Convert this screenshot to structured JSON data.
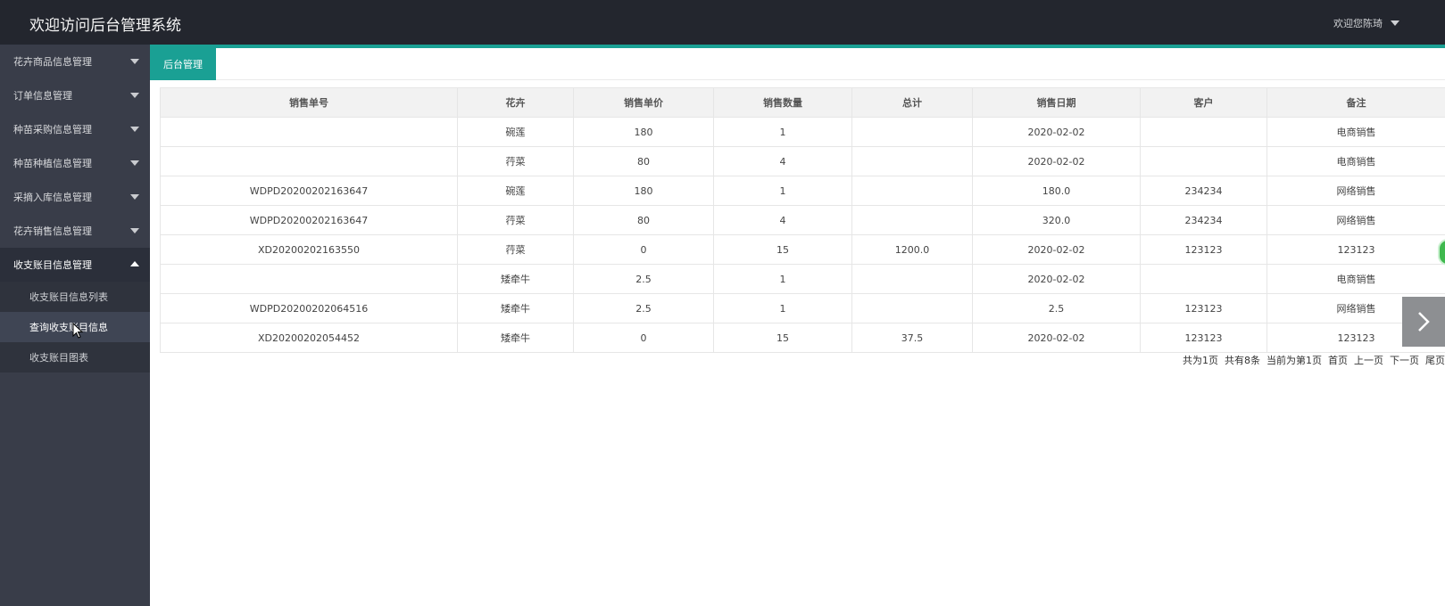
{
  "header": {
    "title": "欢迎访问后台管理系统",
    "user_text": "欢迎您陈琦"
  },
  "sidebar": {
    "items": [
      {
        "label": "花卉商品信息管理"
      },
      {
        "label": "订单信息管理"
      },
      {
        "label": "种苗采购信息管理"
      },
      {
        "label": "种苗种植信息管理"
      },
      {
        "label": "采摘入库信息管理"
      },
      {
        "label": "花卉销售信息管理"
      },
      {
        "label": "收支账目信息管理"
      }
    ],
    "sub_items": [
      {
        "label": "收支账目信息列表"
      },
      {
        "label": "查询收支账目信息"
      },
      {
        "label": "收支账目图表"
      }
    ]
  },
  "tabs": {
    "active": "后台管理"
  },
  "table": {
    "headers": [
      "销售单号",
      "花卉",
      "销售单价",
      "销售数量",
      "总计",
      "销售日期",
      "客户",
      "备注"
    ],
    "rows": [
      [
        "",
        "碗莲",
        "180",
        "1",
        "",
        "2020-02-02",
        "",
        "电商销售"
      ],
      [
        "",
        "荇菜",
        "80",
        "4",
        "",
        "2020-02-02",
        "",
        "电商销售"
      ],
      [
        "WDPD20200202163647",
        "碗莲",
        "180",
        "1",
        "",
        "180.0",
        "234234",
        "网络销售"
      ],
      [
        "WDPD20200202163647",
        "荇菜",
        "80",
        "4",
        "",
        "320.0",
        "234234",
        "网络销售"
      ],
      [
        "XD20200202163550",
        "荇菜",
        "0",
        "15",
        "1200.0",
        "2020-02-02",
        "123123",
        "123123"
      ],
      [
        "",
        "矮牵牛",
        "2.5",
        "1",
        "",
        "2020-02-02",
        "",
        "电商销售"
      ],
      [
        "WDPD20200202064516",
        "矮牵牛",
        "2.5",
        "1",
        "",
        "2.5",
        "123123",
        "网络销售"
      ],
      [
        "XD20200202054452",
        "矮牵牛",
        "0",
        "15",
        "37.5",
        "2020-02-02",
        "123123",
        "123123"
      ]
    ]
  },
  "pager": {
    "total_pages": "共为1页",
    "total_items": "共有8条",
    "current_page": "当前为第1页",
    "first": "首页",
    "prev": "上一页",
    "next": "下一页",
    "last": "尾页"
  },
  "colors": {
    "header_bg": "#23262e",
    "sidebar_bg": "#393d49",
    "accent": "#1aa094"
  },
  "icons": {
    "header_caret": "caret-down-icon",
    "sidebar_arrow": "caret-down-icon",
    "next_slide": "chevron-right-icon"
  }
}
